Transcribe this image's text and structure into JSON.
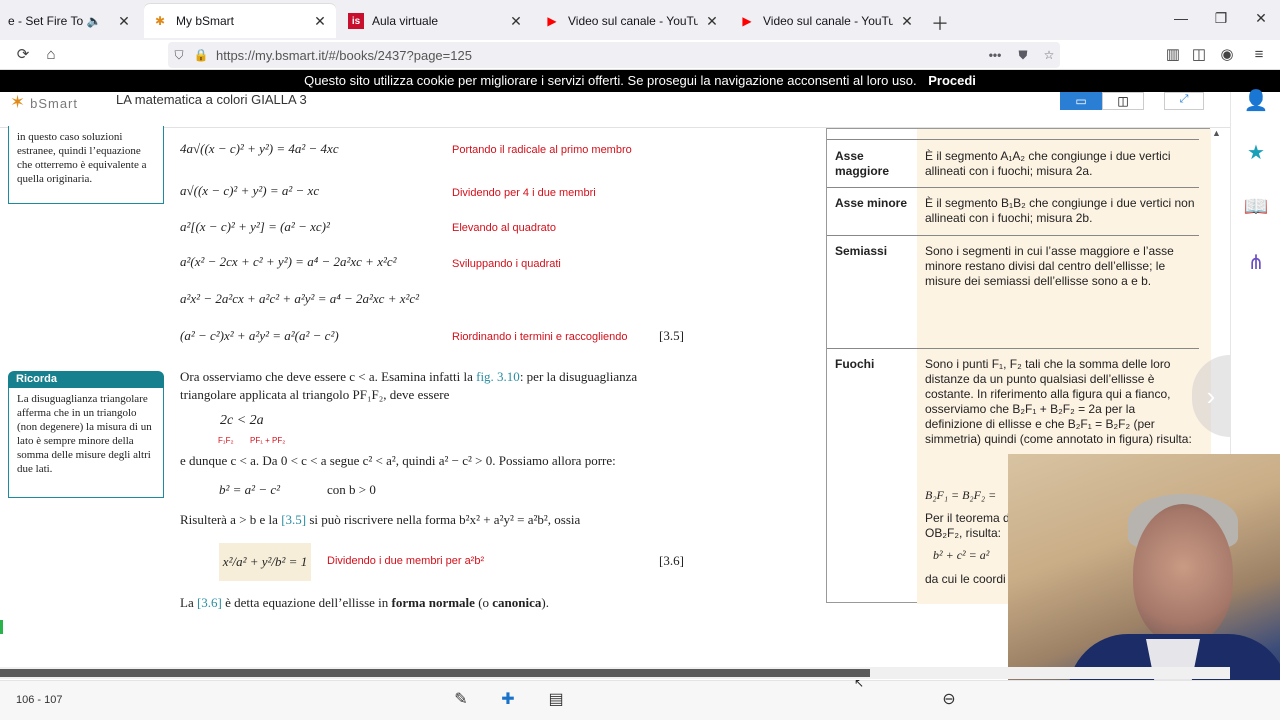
{
  "browser": {
    "tabs": [
      {
        "title": "e - Set Fire To The Rain",
        "icon": "speaker-icon"
      },
      {
        "title": "My bSmart",
        "icon": "bsmart-icon"
      },
      {
        "title": "Aula virtuale",
        "icon": "is-icon"
      },
      {
        "title": "Video sul canale - YouTube Stu",
        "icon": "youtube-icon"
      },
      {
        "title": "Video sul canale - YouTube Stu",
        "icon": "youtube-icon"
      }
    ],
    "url": "https://my.bsmart.it/#/books/2437?page=125"
  },
  "cookie_banner": {
    "text": "Questo sito utilizza cookie per migliorare i servizi offerti. Se prosegui la navigazione acconsenti al loro uso.",
    "action": "Procedi"
  },
  "app": {
    "logo": "bSmart",
    "book_title": "LA matematica a colori GIALLA 3"
  },
  "sidebar_notes": {
    "top_box": "in questo caso soluzioni estranee, quindi l’equazione che otterremo è equivalente a quella originaria.",
    "ricorda_head": "Ricorda",
    "ricorda_body": "La disuguaglianza triangolare afferma che in un triangolo (non degenere) la misura di un lato è sempre minore della somma delle misure degli altri due lati."
  },
  "steps": [
    {
      "math": "4a√((x − c)² + y²) = 4a² − 4xc",
      "note": "Portando il radicale al primo membro"
    },
    {
      "math": "a√((x − c)² + y²) = a² − xc",
      "note": "Dividendo per 4 i due membri"
    },
    {
      "math": "a²[(x − c)² + y²] = (a² − xc)²",
      "note": "Elevando al quadrato"
    },
    {
      "math": "a²(x² − 2cx + c² + y²) = a⁴ − 2a²xc + x²c²",
      "note": "Sviluppando i quadrati"
    },
    {
      "math": "a²x² − 2a²cx + a²c² + a²y² = a⁴ − 2a²xc + x²c²",
      "note": ""
    },
    {
      "math": "(a² − c²)x² + a²y² = a²(a² − c²)",
      "note": "Riordinando i termini e raccogliendo",
      "num": "[3.5]"
    }
  ],
  "paragraphs": {
    "p1_a": "Ora osserviamo che deve essere c < a. Esamina infatti la ",
    "p1_ref": "fig. 3.10",
    "p1_b": ": per la disuguaglianza triangolare applicata al triangolo PF₁F₂, deve essere",
    "ineq": "2c < 2a",
    "ineq_sub_left": "F₁F₂",
    "ineq_sub_right": "PF₁ + PF₂",
    "p2": "e dunque c < a. Da 0 < c < a segue c² < a², quindi a² − c² > 0. Possiamo allora porre:",
    "def_b": "b² = a² − c²",
    "def_cond": "con b > 0",
    "p3_a": "Risulterà a > b e la ",
    "p3_ref": "[3.5]",
    "p3_b": " si può riscrivere nella forma b²x² + a²y² = a²b², ossia",
    "formula": "x²/a² + y²/b² = 1",
    "formula_note": "Dividendo i due membri per a²b²",
    "formula_num": "[3.6]",
    "p4_a": "La ",
    "p4_ref": "[3.6]",
    "p4_b": " è detta equazione dell’ellisse in ",
    "p4_bold1": "forma normale",
    "p4_c": " (o ",
    "p4_bold2": "canonica",
    "p4_d": ")."
  },
  "table": [
    {
      "key": "Asse maggiore",
      "value": "È il segmento A₁A₂ che congiunge i due vertici allineati con i fuochi; misura 2a."
    },
    {
      "key": "Asse minore",
      "value": "È il segmento B₁B₂ che congiunge i due vertici non allineati con i fuochi; misura 2b."
    },
    {
      "key": "Semiassi",
      "value": "Sono i segmenti in cui l’asse maggiore e l’asse minore restano divisi dal centro dell’ellisse; le misure dei semiassi dell’ellisse sono a e b."
    },
    {
      "key": "Fuochi",
      "value": "Sono i punti F₁, F₂ tali che la somma delle loro distanze da un punto qualsiasi dell’ellisse è costante. In riferimento alla figura qui a fianco, osserviamo che B₂F₁ + B₂F₂ = 2a per la definizione di ellisse e che B₂F₁ = B₂F₂ (per simmetria) quindi (come annotato in figura) risulta:"
    },
    {
      "key": "",
      "value": "B₂F₁ = B₂F₂ ="
    },
    {
      "key": "",
      "value": "Per il teorema d"
    },
    {
      "key": "",
      "value": "OB₂F₂, risulta:"
    },
    {
      "key": "",
      "value": "b² + c² = a²"
    },
    {
      "key": "",
      "value": "da cui le coordi"
    }
  ],
  "footer": {
    "pages": "106 - 107"
  },
  "colors": {
    "note_red": "#d4101b",
    "teal": "#16808e",
    "accent_blue": "#1a73c9",
    "table_fill": "#fdf3e3"
  }
}
